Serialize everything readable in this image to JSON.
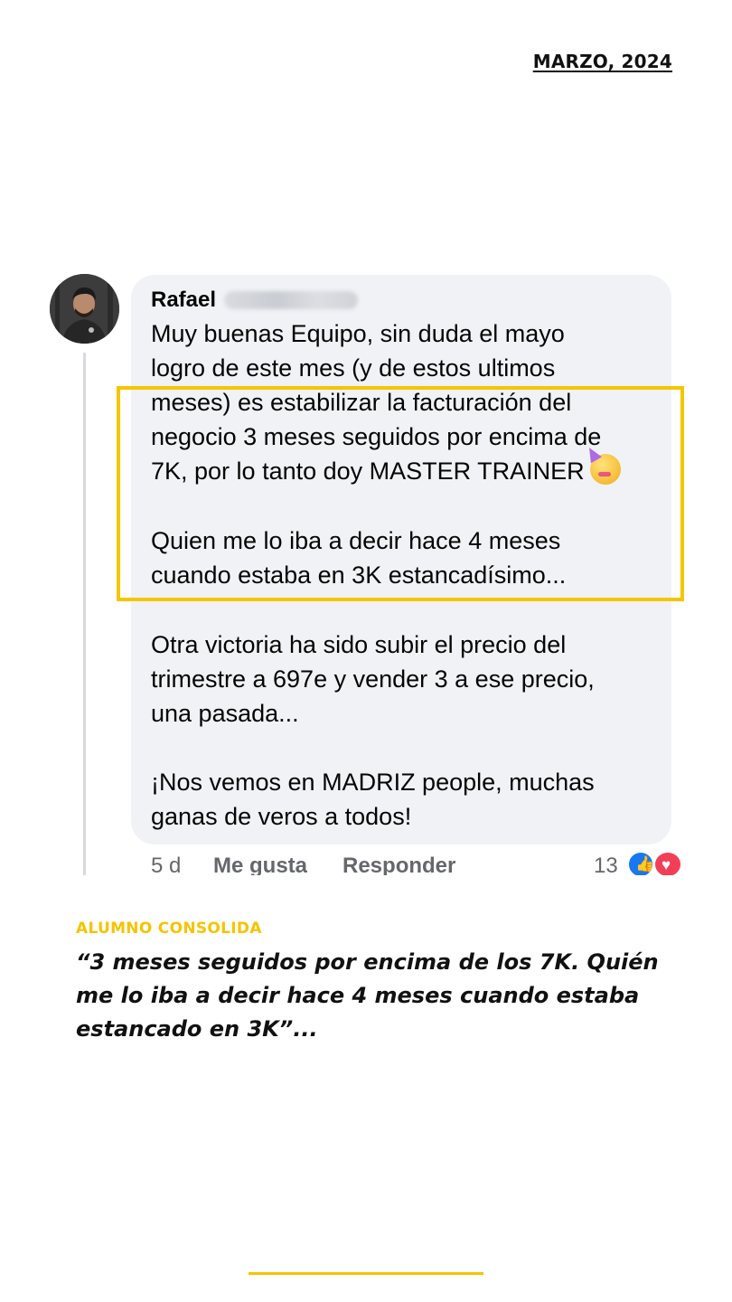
{
  "header": {
    "date": "MARZO, 2024"
  },
  "comment": {
    "author": "Rafael",
    "lines": [
      "Muy buenas Equipo, sin duda el mayo",
      "logro de este mes (y de estos ultimos",
      "meses) es estabilizar la facturación del",
      "negocio 3 meses seguidos por encima de",
      "7K, por lo tanto doy MASTER TRAINER",
      "Quien me lo iba a decir hace 4 meses",
      "cuando estaba en 3K estancadísimo...",
      "Otra victoria ha sido subir el precio del",
      "trimestre a 697e y vender 3 a ese precio,",
      "una pasada...",
      "¡Nos vemos en MADRIZ people, muchas",
      "ganas de veros a todos!"
    ],
    "emoji_icon": "partying-face-emoji",
    "time": "5 d",
    "like_label": "Me gusta",
    "reply_label": "Responder",
    "reaction_count": "13",
    "reactions": [
      "like-reaction-icon",
      "love-reaction-icon"
    ]
  },
  "caption": {
    "label": "ALUMNO CONSOLIDA",
    "quote": "“3 meses seguidos por encima de los 7K. Quién me lo iba a decir hace 4 meses cuando estaba estancado en 3K”..."
  },
  "colors": {
    "accent": "#f5c400",
    "bubble": "#f0f2f5",
    "meta_text": "#65676b",
    "like_blue": "#1877f2",
    "love_red": "#f33e58"
  }
}
